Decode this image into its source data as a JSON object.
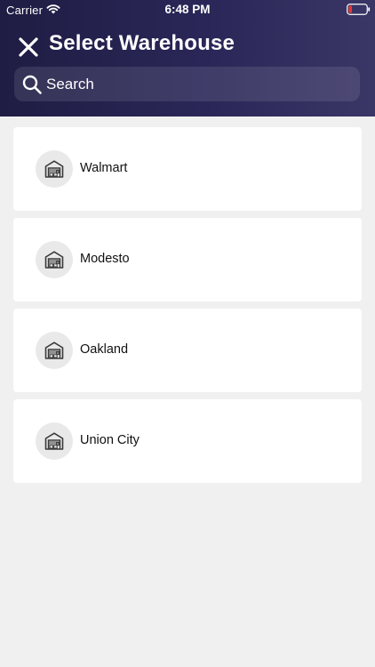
{
  "status_bar": {
    "carrier": "Carrier",
    "time": "6:48 PM",
    "wifi_icon": "wifi-icon",
    "battery_icon": "battery-low-icon",
    "battery_color": "#e53935"
  },
  "header": {
    "title": "Select Warehouse",
    "close_icon": "close-icon",
    "gradient_colors": [
      "#1f1d43",
      "#3a3666"
    ]
  },
  "search": {
    "placeholder": "Search",
    "value": "",
    "icon": "search-icon"
  },
  "warehouses": [
    {
      "name": "Walmart",
      "icon": "warehouse-icon"
    },
    {
      "name": "Modesto",
      "icon": "warehouse-icon"
    },
    {
      "name": "Oakland",
      "icon": "warehouse-icon"
    },
    {
      "name": "Union City",
      "icon": "warehouse-icon"
    }
  ]
}
